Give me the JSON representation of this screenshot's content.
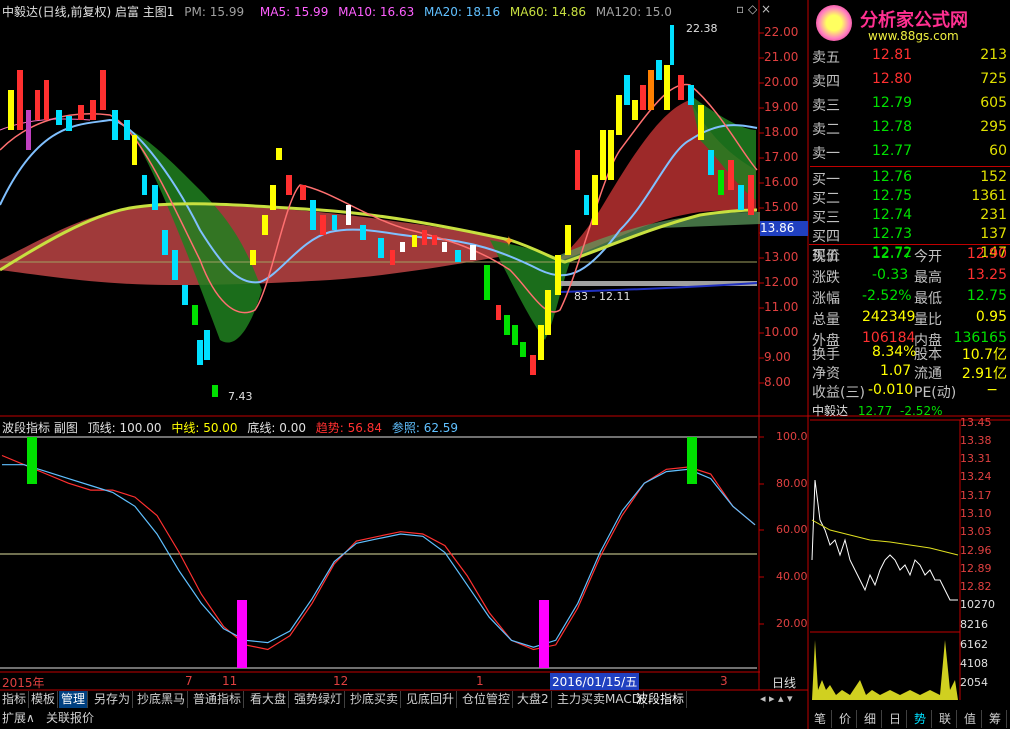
{
  "main": {
    "title": "中毅达(日线,前复权) 启富 主图1",
    "pm_label": "PM: 15.99",
    "pm_value": "15.99",
    "ma5": "MA5: 15.99",
    "ma10": "MA10: 16.63",
    "ma20": "MA20: 18.16",
    "ma60": "MA60: 14.86",
    "ma120": "MA120: 15.0",
    "y_ticks": [
      "22.00",
      "21.00",
      "20.00",
      "19.00",
      "18.00",
      "17.00",
      "16.00",
      "15.00",
      "14.00",
      "13.00",
      "12.00",
      "11.00",
      "10.00",
      "9.00",
      "8.00"
    ],
    "price_tag": "13.86",
    "high_label": "22.38",
    "low_label": "7.43",
    "mid_label": "83 - 12.11"
  },
  "brand": {
    "name": "分析家公式网",
    "url": "www.88gs.com"
  },
  "order_book": {
    "asks": [
      {
        "label": "卖五",
        "price": "12.81",
        "vol": "213"
      },
      {
        "label": "卖四",
        "price": "12.80",
        "vol": "725"
      },
      {
        "label": "卖三",
        "price": "12.79",
        "vol": "605"
      },
      {
        "label": "卖二",
        "price": "12.78",
        "vol": "295"
      },
      {
        "label": "卖一",
        "price": "12.77",
        "vol": "60"
      }
    ],
    "bids": [
      {
        "label": "买一",
        "price": "12.76",
        "vol": "152"
      },
      {
        "label": "买二",
        "price": "12.75",
        "vol": "1361"
      },
      {
        "label": "买三",
        "price": "12.74",
        "vol": "231"
      },
      {
        "label": "买四",
        "price": "12.73",
        "vol": "137"
      },
      {
        "label": "买五",
        "price": "12.72",
        "vol": "147"
      }
    ]
  },
  "quote": {
    "r1": {
      "l1": "现价",
      "v1": "12.77",
      "l2": "今开",
      "v2": "12.90"
    },
    "r2": {
      "l1": "涨跌",
      "v1": "-0.33",
      "l2": "最高",
      "v2": "13.25"
    },
    "r3": {
      "l1": "涨幅",
      "v1": "-2.52%",
      "l2": "最低",
      "v2": "12.75"
    },
    "r4": {
      "l1": "总量",
      "v1": "242349",
      "l2": "量比",
      "v2": "0.95"
    },
    "r5": {
      "l1": "外盘",
      "v1": "106184",
      "l2": "内盘",
      "v2": "136165"
    },
    "r6": {
      "l1": "换手",
      "v1": "8.34%",
      "l2": "股本",
      "v2": "10.7亿"
    },
    "r7": {
      "l1": "净资",
      "v1": "1.07",
      "l2": "流通",
      "v2": "2.91亿"
    },
    "r8": {
      "l1": "收益(三)",
      "v1": "-0.010",
      "l2": "PE(动)",
      "v2": "−"
    }
  },
  "mini": {
    "name": "中毅达",
    "price": "12.77",
    "change": "-2.52%",
    "y_left": [
      "100.0",
      "80.00",
      "60.00",
      "40.00",
      "20.00"
    ],
    "y_right": [
      "13.45",
      "13.38",
      "13.31",
      "13.24",
      "13.17",
      "13.10",
      "13.03",
      "12.96",
      "12.89",
      "12.82",
      "10270",
      "8216",
      "6162",
      "4108",
      "2054"
    ]
  },
  "sub": {
    "name": "波段指标 副图",
    "top": "顶线: 100.00",
    "mid": "中线: 50.00",
    "bottom": "底线: 0.00",
    "trend": "趋势: 56.84",
    "ref": "参照: 62.59",
    "y_ticks": [
      "100.0",
      "80.00",
      "60.00",
      "40.00",
      "20.00"
    ]
  },
  "timeline": {
    "year": "2015年",
    "m7": "7",
    "m11": "11",
    "m12": "12",
    "m1": "1",
    "date": "2016/01/15/五",
    "m3": "3"
  },
  "tabs": [
    "指标",
    "模板",
    "管理",
    "另存为",
    "抄底黑马",
    "普通指标",
    "看大盘",
    "强势绿灯",
    "抄底买卖",
    "见底回升",
    "仓位管控",
    "大盘2",
    "主力买卖MACD",
    "波段指标"
  ],
  "bottom_tabs": {
    "expand": "扩展∧",
    "related": "关联报价"
  },
  "period": "日线",
  "side_tabs": [
    "笔",
    "价",
    "细",
    "日",
    "势",
    "联",
    "值",
    "筹"
  ],
  "colors": {
    "up": "#ff3030",
    "down": "#00e000",
    "yellow": "#ffff00",
    "cyan": "#00e0ff",
    "magenta": "#ff00ff",
    "axis": "#c00000"
  },
  "chart_data": {
    "type": "line",
    "series": [
      {
        "values": [
          92,
          88,
          84,
          80,
          77,
          77,
          74,
          66,
          50,
          32,
          18,
          10,
          8,
          14,
          28,
          45,
          55,
          57,
          59,
          58,
          53,
          40,
          24,
          12,
          8,
          10,
          26,
          48,
          66,
          80,
          86,
          87,
          84,
          70,
          62
        ]
      },
      {
        "values": [
          88,
          88,
          85,
          82,
          79,
          76,
          70,
          58,
          42,
          28,
          17,
          12,
          11,
          16,
          30,
          46,
          54,
          56,
          58,
          57,
          50,
          36,
          22,
          12,
          9,
          12,
          28,
          50,
          68,
          80,
          85,
          86,
          82,
          70,
          62
        ]
      }
    ]
  }
}
